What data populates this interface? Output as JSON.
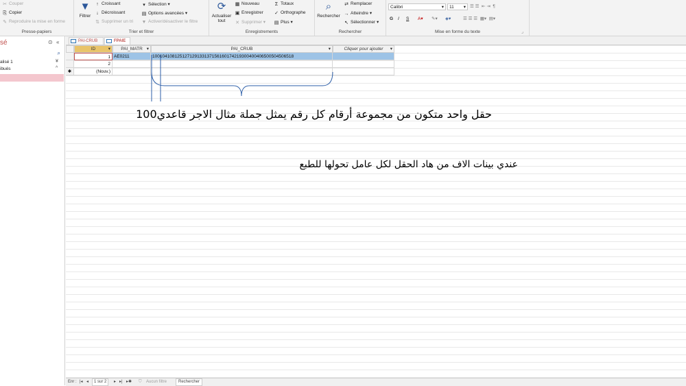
{
  "ribbon": {
    "clipboard": {
      "cut": "Couper",
      "copy": "Copier",
      "format_painter": "Reproduire la mise en forme",
      "label": "Presse-papiers"
    },
    "sort_filter": {
      "filter": "Filtrer",
      "ascending": "Croissant",
      "descending": "Décroissant",
      "remove_sort": "Supprimer un tri",
      "selection": "Sélection",
      "advanced": "Options avancées",
      "toggle_filter": "Activer/désactiver le filtre",
      "label": "Trier et filtrer"
    },
    "records": {
      "refresh": "Actualiser tout",
      "new": "Nouveau",
      "save": "Enregistrer",
      "delete": "Supprimer",
      "totals": "Totaux",
      "spelling": "Orthographe",
      "more": "Plus",
      "label": "Enregistrements"
    },
    "find": {
      "find": "Rechercher",
      "replace": "Remplacer",
      "goto": "Atteindre",
      "select": "Sélectionner",
      "label": "Rechercher"
    },
    "text_format": {
      "font": "Calibri",
      "size": "11",
      "bold": "G",
      "italic": "I",
      "underline": "S",
      "label": "Mise en forme du texte"
    }
  },
  "nav_pane": {
    "title": "sé",
    "items": [
      "alisé 1",
      "ibués"
    ]
  },
  "tabs": [
    "PAI-CRUB",
    "FPAIE"
  ],
  "table": {
    "columns": [
      "ID",
      "PAI_MATR",
      "PAI_CRUB",
      "Cliquer pour ajouter"
    ],
    "rows": [
      {
        "id": "1",
        "matr": "AE0211",
        "crub": "10010410812512712913313715616017421930040040650050450651​8"
      },
      {
        "id": "2",
        "matr": "",
        "crub": ""
      }
    ],
    "new_row": "(Nouv.)"
  },
  "status": {
    "record_label": "Enr :",
    "position": "1 sur 2",
    "filter": "Aucun filtre",
    "search": "Rechercher"
  },
  "annotations": {
    "line1": "حقل واحد متكون من مجموعة أرقام كل رقم يمثل جملة مثال  الاجر قاعدي100",
    "line2": "عندي بينات الاف من هاد الحقل لكل عامل تحولها للطبع"
  },
  "colors": {
    "accent": "#c0504d",
    "selected_row": "#9dc3e6",
    "id_header": "#e9c46a"
  }
}
